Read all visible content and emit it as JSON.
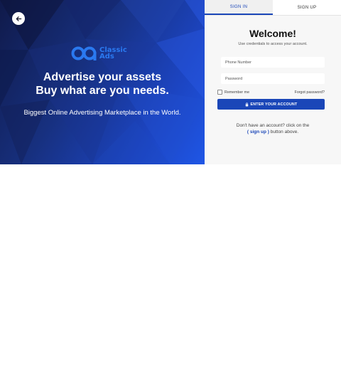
{
  "hero": {
    "back_label": "Back",
    "logo_line1": "Classic",
    "logo_line2": "Ads",
    "headline_line1": "Advertise your assets",
    "headline_line2": "Buy what are you needs.",
    "tagline": "Biggest Online Advertising Marketplace in the World."
  },
  "tabs": [
    {
      "label": "SIGN IN",
      "active": true
    },
    {
      "label": "SIGN UP",
      "active": false
    }
  ],
  "form": {
    "title": "Welcome!",
    "subtitle": "Use credentials to access your account.",
    "phone_placeholder": "Phone Number",
    "password_placeholder": "Password",
    "remember_label": "Remember me",
    "forgot_label": "Forgot password?",
    "submit_label": "ENTER YOUR ACCOUNT",
    "signup_prefix": "Don't have an account? click on the",
    "signup_link": "( sign up )",
    "signup_suffix": " button above."
  },
  "colors": {
    "primary": "#1a46b8",
    "hero_dark": "#101a4a",
    "hero_light": "#1f56e6",
    "logo": "#2a79f0"
  },
  "icons": {
    "back": "arrow-left-icon",
    "submit": "lock-icon"
  }
}
